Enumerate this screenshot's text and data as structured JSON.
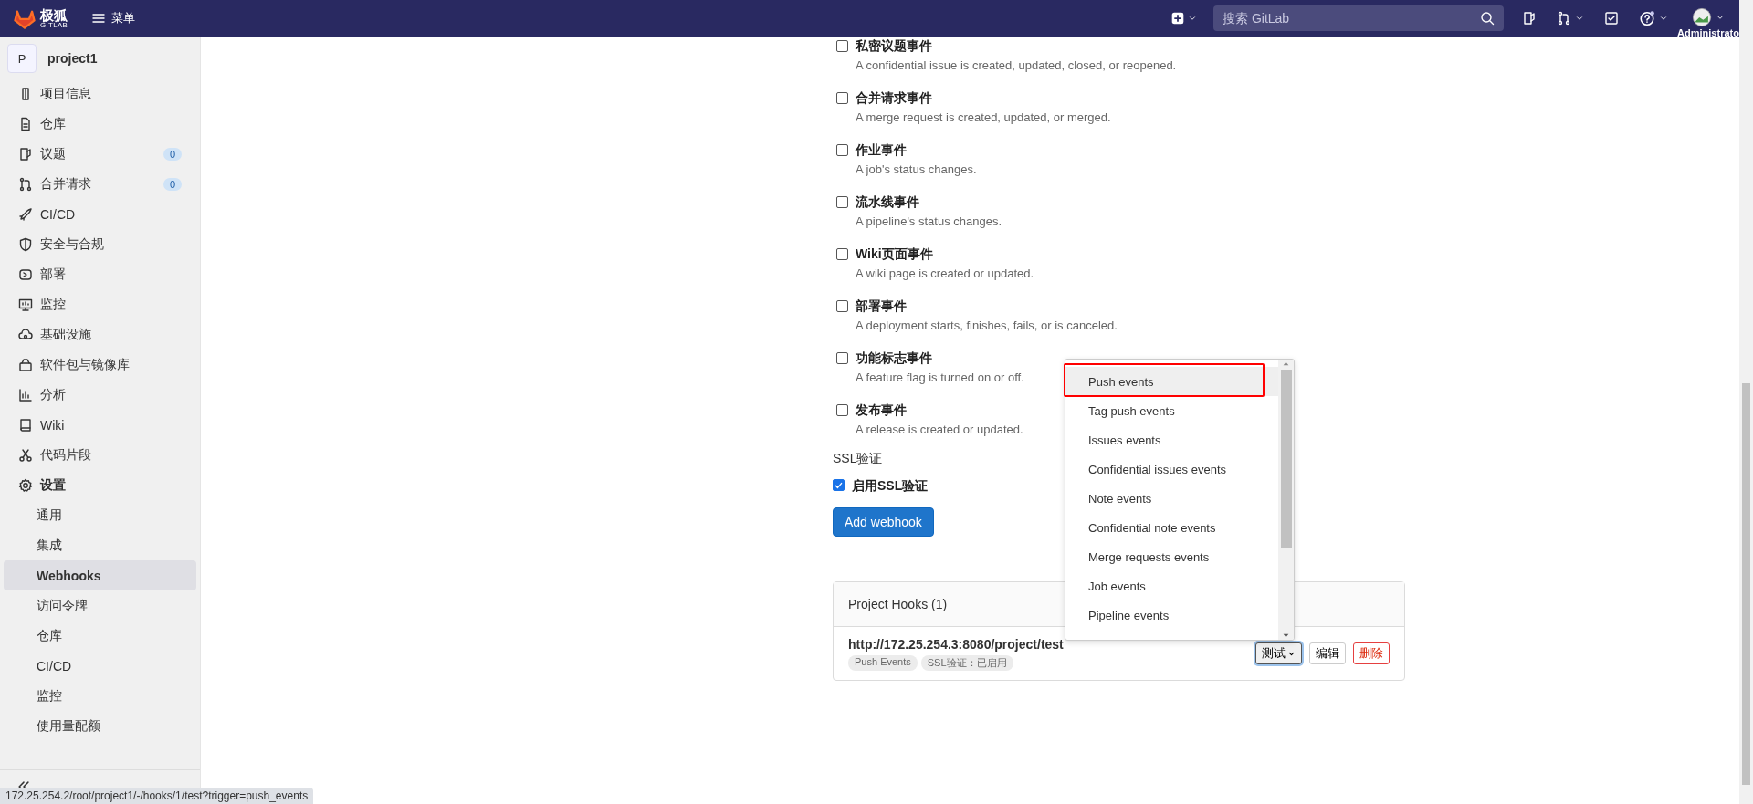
{
  "header": {
    "logo_text": "极狐",
    "logo_sub": "GITLAB",
    "menu": "菜单",
    "search": {
      "placeholder": "搜索 GitLab"
    },
    "user": "Administrato"
  },
  "sidebar": {
    "project": {
      "avatar": "P",
      "name": "project1"
    },
    "items": [
      {
        "label": "项目信息"
      },
      {
        "label": "仓库"
      },
      {
        "label": "议题",
        "badge": "0"
      },
      {
        "label": "合并请求",
        "badge": "0"
      },
      {
        "label": "CI/CD"
      },
      {
        "label": "安全与合规"
      },
      {
        "label": "部署"
      },
      {
        "label": "监控"
      },
      {
        "label": "基础设施"
      },
      {
        "label": "软件包与镜像库"
      },
      {
        "label": "分析"
      },
      {
        "label": "Wiki"
      },
      {
        "label": "代码片段"
      },
      {
        "label": "设置",
        "expanded": true,
        "children": [
          {
            "label": "通用",
            "selected": false
          },
          {
            "label": "集成",
            "selected": false
          },
          {
            "label": "Webhooks",
            "selected": true
          },
          {
            "label": "访问令牌",
            "selected": false
          },
          {
            "label": "仓库",
            "selected": false
          },
          {
            "label": "CI/CD",
            "selected": false
          },
          {
            "label": "监控",
            "selected": false
          },
          {
            "label": "使用量配额",
            "selected": false
          }
        ]
      }
    ]
  },
  "main": {
    "events": [
      {
        "label": "私密议题事件",
        "description": "A confidential issue is created, updated, closed, or reopened.",
        "checked": false
      },
      {
        "label": "合并请求事件",
        "description": "A merge request is created, updated, or merged.",
        "checked": false
      },
      {
        "label": "作业事件",
        "description": "A job's status changes.",
        "checked": false
      },
      {
        "label": "流水线事件",
        "description": "A pipeline's status changes.",
        "checked": false
      },
      {
        "label": "Wiki页面事件",
        "description": "A wiki page is created or updated.",
        "checked": false
      },
      {
        "label": "部署事件",
        "description": "A deployment starts, finishes, fails, or is canceled.",
        "checked": false
      },
      {
        "label": "功能标志事件",
        "description": "A feature flag is turned on or off.",
        "checked": false
      },
      {
        "label": "发布事件",
        "description": "A release is created or updated.",
        "checked": false
      }
    ],
    "ssl": {
      "heading": "SSL验证",
      "label": "启用SSL验证",
      "checked": true
    },
    "add_button": "Add webhook",
    "hooks": {
      "title": "Project Hooks (1)",
      "items": [
        {
          "url": "http://172.25.254.3:8080/project/test",
          "tags": [
            "Push Events",
            "SSL验证：已启用"
          ],
          "test_button": "测试",
          "edit_button": "编辑",
          "delete_button": "删除"
        }
      ]
    }
  },
  "dropdown": {
    "items": [
      {
        "label": "Push events",
        "selected": true
      },
      {
        "label": "Tag push events",
        "selected": false
      },
      {
        "label": "Issues events",
        "selected": false
      },
      {
        "label": "Confidential issues events",
        "selected": false
      },
      {
        "label": "Note events",
        "selected": false
      },
      {
        "label": "Confidential note events",
        "selected": false
      },
      {
        "label": "Merge requests events",
        "selected": false
      },
      {
        "label": "Job events",
        "selected": false
      },
      {
        "label": "Pipeline events",
        "selected": false
      }
    ]
  },
  "status_bar": "172.25.254.2/root/project1/-/hooks/1/test?trigger=push_events"
}
